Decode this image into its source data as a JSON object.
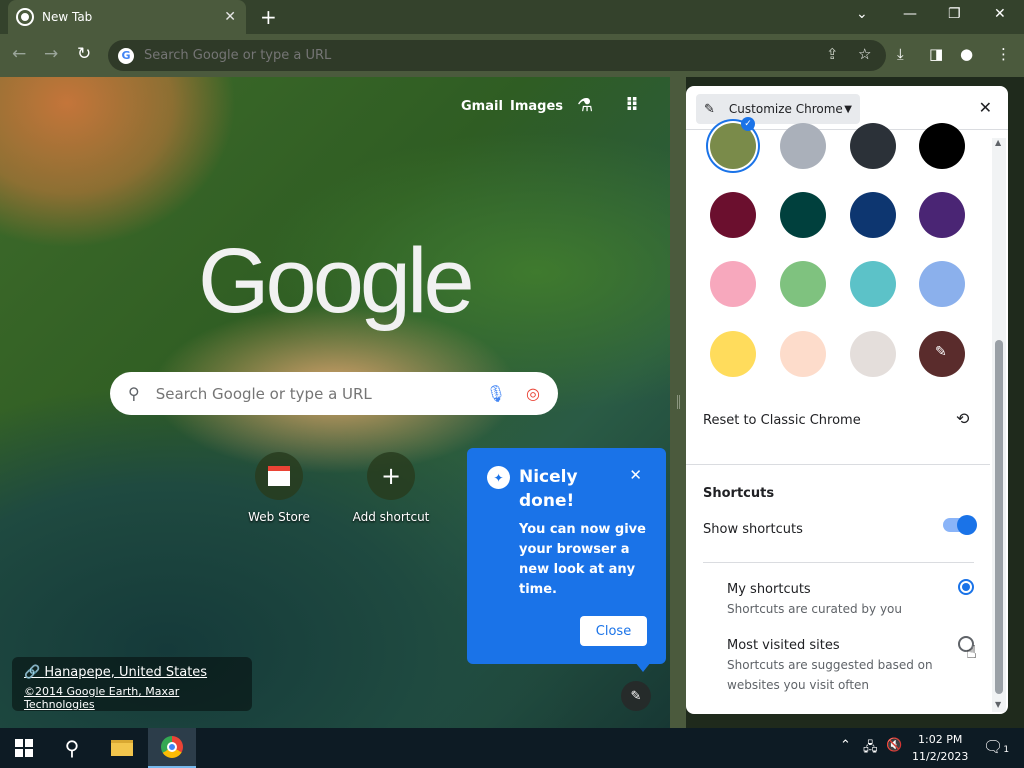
{
  "browser": {
    "tab_title": "New Tab",
    "omnibox_placeholder": "Search Google or type a URL"
  },
  "ntp": {
    "gmail": "Gmail",
    "images": "Images",
    "logo": "Google",
    "search_placeholder": "Search Google or type a URL",
    "shortcuts": [
      {
        "label": "Web Store"
      },
      {
        "label": "Add shortcut"
      }
    ],
    "attribution_location": "Hanapepe, United States",
    "attribution_copyright": "©2014 Google Earth, Maxar Technologies"
  },
  "callout": {
    "title": "Nicely done!",
    "body": "You can now give your browser a new look at any time.",
    "close_label": "Close"
  },
  "panel": {
    "selector_label": "Customize Chrome",
    "colors": [
      "#7a8b4a",
      "#aab0ba",
      "#2b3138",
      "#000000",
      "#6b0f2e",
      "#00403d",
      "#0d3670",
      "#4a2574",
      "#f7a8bd",
      "#7fc27f",
      "#5cc2c8",
      "#8bb0ec",
      "#ffdc5c",
      "#fddccb",
      "#e4dedb",
      "#5a2c2c"
    ],
    "selected_color_index": 0,
    "reset_label": "Reset to Classic Chrome",
    "shortcuts_heading": "Shortcuts",
    "show_shortcuts_label": "Show shortcuts",
    "show_shortcuts_on": true,
    "options": [
      {
        "title": "My shortcuts",
        "subtitle": "Shortcuts are curated by you",
        "selected": true
      },
      {
        "title": "Most visited sites",
        "subtitle": "Shortcuts are suggested based on websites you visit often",
        "selected": false
      }
    ]
  },
  "taskbar": {
    "time": "1:02 PM",
    "date": "11/2/2023",
    "notification_count": "1"
  }
}
